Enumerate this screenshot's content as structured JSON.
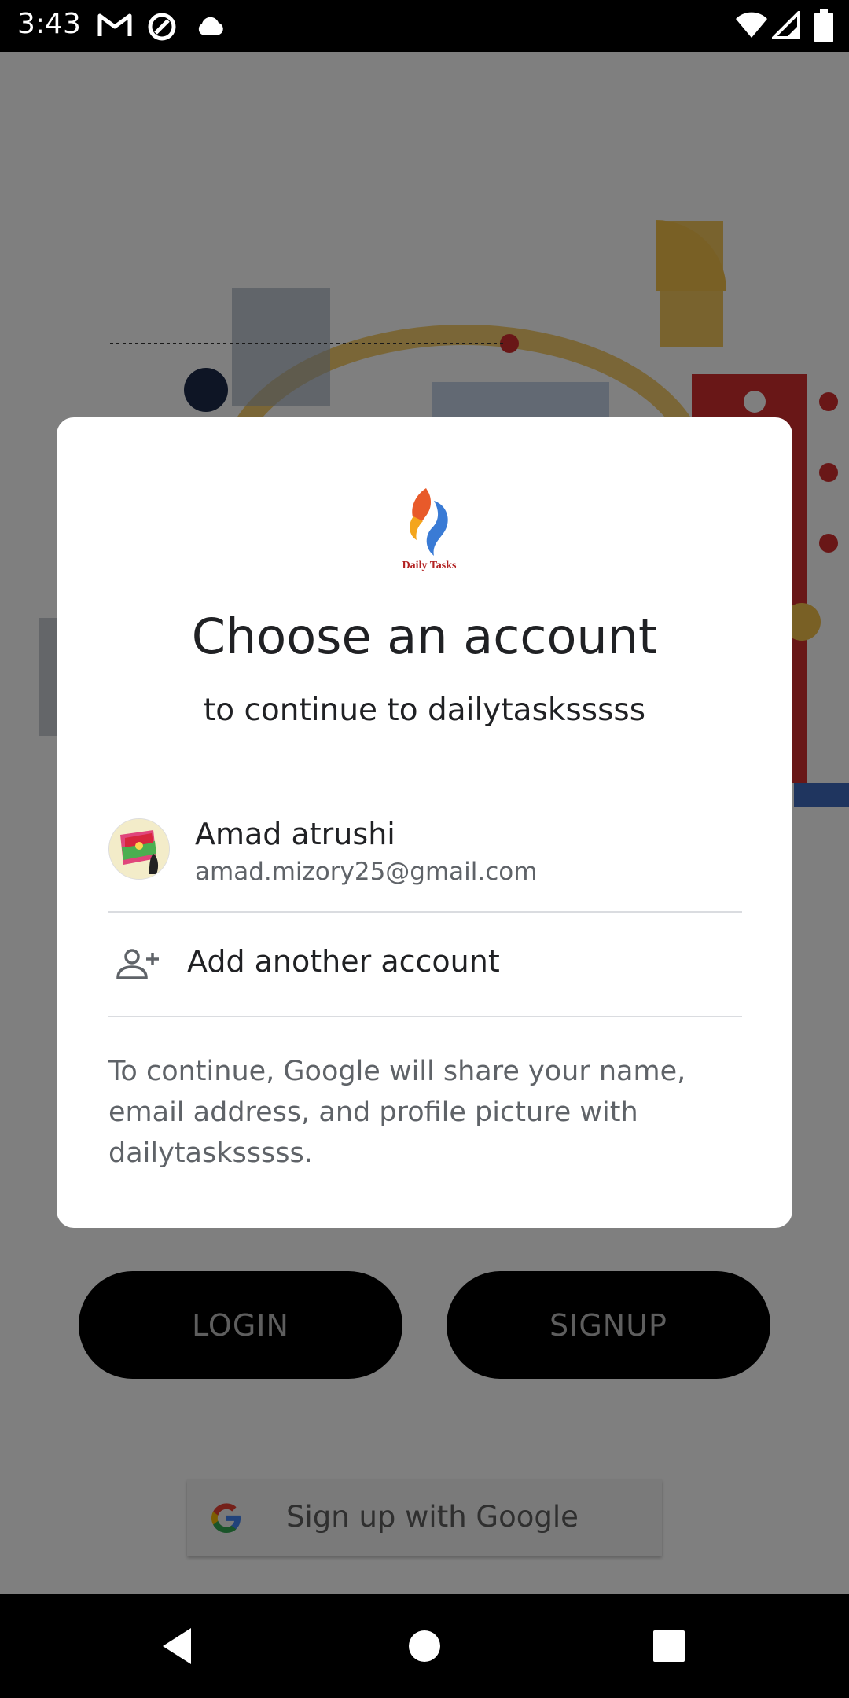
{
  "status_bar": {
    "time": "3:43",
    "icons": [
      "gmail-icon",
      "sync-icon",
      "cloud-icon",
      "wifi-icon",
      "signal-icon",
      "battery-icon"
    ]
  },
  "dialog": {
    "logo_text": "Daily Tasks",
    "title": "Choose an account",
    "subtitle": "to continue to dailytasksssss",
    "account": {
      "name": "Amad atrushi",
      "email": "amad.mizory25@gmail.com"
    },
    "add_account_label": "Add another account",
    "disclaimer": "To continue, Google will share your name, email address, and profile picture with dailytasksssss."
  },
  "background_app": {
    "login_label": "LOGIN",
    "signup_label": "SIGNUP",
    "google_signup_label": "Sign up with Google"
  },
  "nav_bar": {
    "icons": [
      "back-icon",
      "home-icon",
      "recents-icon"
    ]
  },
  "colors": {
    "scrim": "#000000",
    "dialog_bg": "#ffffff",
    "title_text": "#202124",
    "secondary_text": "#5f6368",
    "divider": "#dadce0"
  }
}
